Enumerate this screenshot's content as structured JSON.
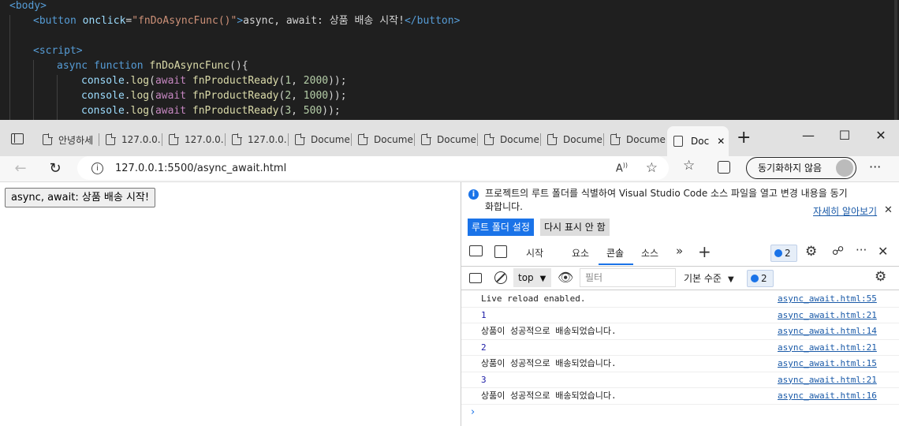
{
  "code": {
    "body_open": "<body>",
    "button_open": "<button ",
    "onclick_attr": "onclick",
    "onclick_eq": "=",
    "onclick_val": "\"fnDoAsyncFunc()\"",
    "button_gt": ">",
    "button_text": "async, await: 상품 배송 시작!",
    "button_close": "</button>",
    "script_open": "<script>",
    "async_kw": "async",
    "function_kw": "function",
    "fn_name": "fnDoAsyncFunc",
    "fn_paren": "(){",
    "log_lines": [
      {
        "obj": "console",
        "dot": ".",
        "fn": "log",
        "paren": "(",
        "await": "await",
        "call": "fnProductReady",
        "args_open": "(",
        "n1": "1",
        "comma": ", ",
        "n2": "2000",
        "close": "));"
      },
      {
        "obj": "console",
        "dot": ".",
        "fn": "log",
        "paren": "(",
        "await": "await",
        "call": "fnProductReady",
        "args_open": "(",
        "n1": "2",
        "comma": ", ",
        "n2": "1000",
        "close": "));"
      },
      {
        "obj": "console",
        "dot": ".",
        "fn": "log",
        "paren": "(",
        "await": "await",
        "call": "fnProductReady",
        "args_open": "(",
        "n1": "3",
        "comma": ", ",
        "n2": "500",
        "close": "));"
      }
    ]
  },
  "tabs": [
    {
      "label": "안녕하세"
    },
    {
      "label": "127.0.0."
    },
    {
      "label": "127.0.0."
    },
    {
      "label": "127.0.0."
    },
    {
      "label": "Docume"
    },
    {
      "label": "Docume"
    },
    {
      "label": "Docume"
    },
    {
      "label": "Docume"
    },
    {
      "label": "Docume"
    },
    {
      "label": "Docume"
    }
  ],
  "active_tab": {
    "label": "Doc",
    "close": "✕"
  },
  "new_tab": "+",
  "window": {
    "minimize": "—",
    "maximize": "☐",
    "close": "✕"
  },
  "address": {
    "info": "i",
    "url": "127.0.0.1:5500/async_await.html",
    "sync": "동기화하지 않음",
    "menu": "···"
  },
  "page": {
    "button": "async, await: 상품 배송 시작!"
  },
  "devtools": {
    "info": {
      "icon": "i",
      "message": "프로젝트의 루트 폴더를 식별하여 Visual Studio Code 소스 파일을 열고 변경 내용을 동기화합니다.",
      "learn_more": "자세히 알아보기",
      "close": "✕",
      "set_root": "루트 폴더 설정",
      "dont_show": "다시 표시 안 함"
    },
    "tabs": [
      "시작",
      "요소",
      "콘솔",
      "소스"
    ],
    "more": "»",
    "add": "+",
    "issues_count": "2",
    "toolbar": {
      "context": "top",
      "filter_placeholder": "필터",
      "level": "기본 수준",
      "issues_count": "2"
    },
    "log": [
      {
        "msg": "Live reload enabled.",
        "src": "async_await.html:55",
        "num": false
      },
      {
        "msg": "1",
        "src": "async_await.html:21",
        "num": true
      },
      {
        "msg": "상품이 성공적으로 배송되었습니다.",
        "src": "async_await.html:14",
        "num": false
      },
      {
        "msg": "2",
        "src": "async_await.html:21",
        "num": true
      },
      {
        "msg": "상품이 성공적으로 배송되었습니다.",
        "src": "async_await.html:15",
        "num": false
      },
      {
        "msg": "3",
        "src": "async_await.html:21",
        "num": true
      },
      {
        "msg": "상품이 성공적으로 배송되었습니다.",
        "src": "async_await.html:16",
        "num": false
      }
    ],
    "prompt": "›"
  },
  "colors": {
    "accent": "#1a73e8",
    "editor_bg": "#1f1f1f"
  }
}
